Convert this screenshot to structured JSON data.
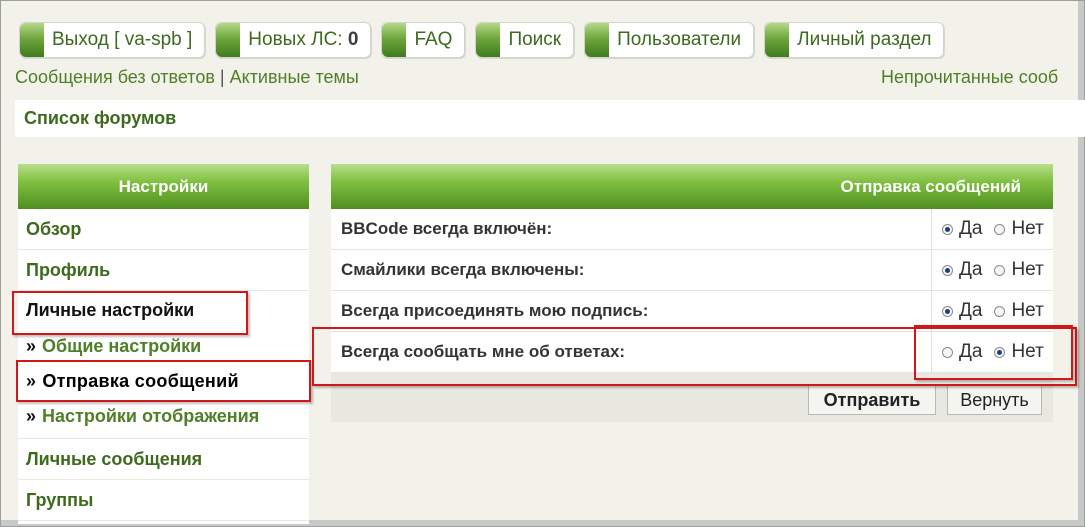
{
  "nav": {
    "logout": "Выход [ va-spb ]",
    "new_pm_label": "Новых ЛС:",
    "new_pm_count": "0",
    "faq": "FAQ",
    "search": "Поиск",
    "users": "Пользователи",
    "personal": "Личный раздел"
  },
  "links": {
    "no_replies": "Сообщения без ответов",
    "separator": "|",
    "active": "Активные темы",
    "unread": "Непрочитанные сооб"
  },
  "breadcrumb": "Список форумов",
  "sidebar": {
    "header": "Настройки",
    "overview": "Обзор",
    "profile": "Профиль",
    "personal_settings": "Личные настройки",
    "sub_arrow": "»",
    "sub_items": [
      "Общие настройки",
      "Отправка сообщений",
      "Настройки отображения"
    ],
    "pm": "Личные сообщения",
    "groups": "Группы"
  },
  "content": {
    "header": "Отправка сообщений",
    "yes": "Да",
    "no": "Нет",
    "rows": [
      {
        "label": "BBCode всегда включён:",
        "value": "yes"
      },
      {
        "label": "Смайлики всегда включены:",
        "value": "yes"
      },
      {
        "label": "Всегда присоединять мою подпись:",
        "value": "yes"
      },
      {
        "label": "Всегда сообщать мне об ответах:",
        "value": "no"
      }
    ],
    "submit": "Отправить",
    "reset": "Вернуть"
  },
  "colors": {
    "green_text": "#4f7f27",
    "highlight": "#d01818"
  }
}
